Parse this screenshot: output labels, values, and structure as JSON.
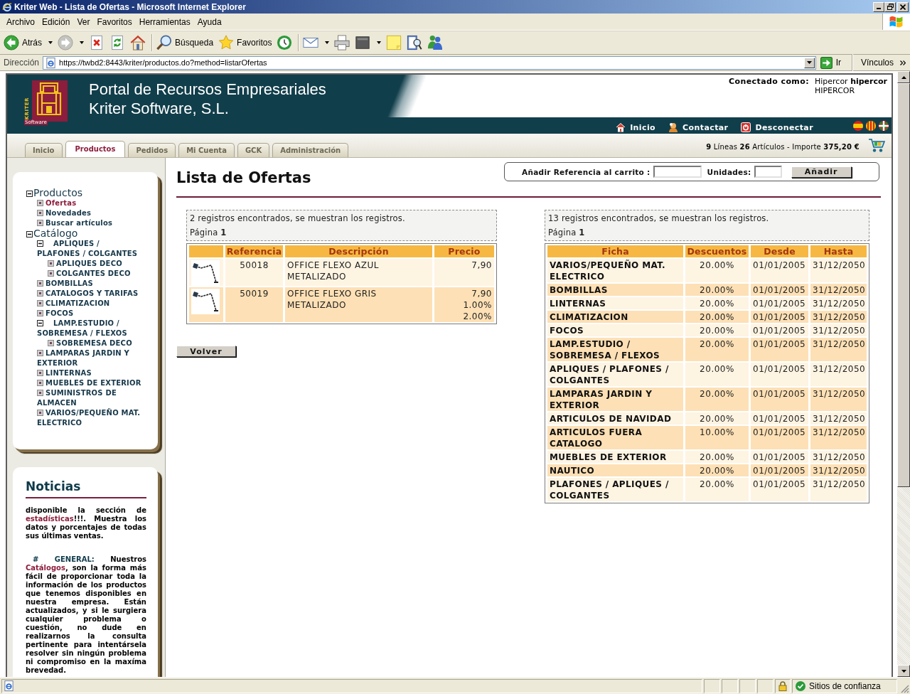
{
  "window": {
    "title": "Kriter Web - Lista de Ofertas - Microsoft Internet Explorer"
  },
  "menu_bar": [
    "Archivo",
    "Edición",
    "Ver",
    "Favoritos",
    "Herramientas",
    "Ayuda"
  ],
  "toolbar": [
    {
      "kind": "back",
      "label": "Atrás"
    },
    {
      "kind": "forward"
    },
    {
      "kind": "stop"
    },
    {
      "kind": "refresh"
    },
    {
      "kind": "home"
    },
    {
      "kind": "search",
      "label": "Búsqueda"
    },
    {
      "kind": "favorites",
      "label": "Favoritos"
    },
    {
      "kind": "history"
    },
    {
      "kind": "mail"
    },
    {
      "kind": "print"
    },
    {
      "kind": "edit"
    },
    {
      "kind": "notes"
    },
    {
      "kind": "research"
    },
    {
      "kind": "messenger"
    }
  ],
  "address_bar": {
    "label": "Dirección",
    "url": "https://twbd2:8443/kriter/productos.do?method=listarOfertas",
    "go": "Ir",
    "links": "Vínculos"
  },
  "header": {
    "logo_vertical": "KRITER",
    "logo_caption": "Software",
    "title_lines": [
      "Portal de Recursos Empresariales",
      "Kriter Software, S.L."
    ],
    "connected_label": "Conectado como:",
    "user": "Hipercor **hipercor**",
    "company": "HIPERCOR",
    "nav": [
      {
        "kind": "home",
        "label": "Inicio"
      },
      {
        "kind": "contact",
        "label": "Contactar"
      },
      {
        "kind": "logout",
        "label": "Desconectar"
      }
    ]
  },
  "tabs": [
    {
      "label": "Inicio",
      "selected": false
    },
    {
      "label": "Productos",
      "selected": true
    },
    {
      "label": "Pedidos",
      "selected": false
    },
    {
      "label": "Mi Cuenta",
      "selected": false
    },
    {
      "label": "GCK",
      "selected": false
    },
    {
      "label": "Administración",
      "selected": false
    }
  ],
  "cart_summary": "**9** Líneas **26** Artículos - Importe **375,20 €**",
  "sidebar": {
    "tree": [
      {
        "label": "Productos",
        "expanded": true,
        "selected": false,
        "children": [
          {
            "label": "Ofertas",
            "expanded": false,
            "selected": true
          },
          {
            "label": "Novedades",
            "expanded": false,
            "selected": false
          },
          {
            "label": "Buscar artículos",
            "expanded": false,
            "selected": false
          }
        ]
      },
      {
        "label": "Catálogo",
        "expanded": true,
        "selected": false,
        "children": [
          {
            "label": "APLIQUES / PLAFONES / COLGANTES",
            "expanded": true,
            "selected": false,
            "children": [
              {
                "label": "APLIQUES DECO",
                "expanded": false,
                "selected": false
              },
              {
                "label": "COLGANTES DECO",
                "expanded": false,
                "selected": false
              }
            ]
          },
          {
            "label": "BOMBILLAS",
            "expanded": false,
            "selected": false
          },
          {
            "label": "CATALOGOS Y TARIFAS",
            "expanded": false,
            "selected": false
          },
          {
            "label": "CLIMATIZACION",
            "expanded": false,
            "selected": false
          },
          {
            "label": "FOCOS",
            "expanded": false,
            "selected": false
          },
          {
            "label": "LAMP.ESTUDIO / SOBREMESA / FLEXOS",
            "expanded": true,
            "selected": false,
            "children": [
              {
                "label": "SOBREMESA DECO",
                "expanded": false,
                "selected": false
              }
            ]
          },
          {
            "label": "LAMPARAS JARDIN Y EXTERIOR",
            "expanded": false,
            "selected": false
          },
          {
            "label": "LINTERNAS",
            "expanded": false,
            "selected": false
          },
          {
            "label": "MUEBLES DE EXTERIOR",
            "expanded": false,
            "selected": false
          },
          {
            "label": "SUMINISTROS DE ALMACEN",
            "expanded": false,
            "selected": false
          },
          {
            "label": "VARIOS/PEQUEÑO MAT. ELECTRICO",
            "expanded": false,
            "selected": false
          }
        ]
      }
    ]
  },
  "news": {
    "title": "Noticias",
    "paragraphs": [
      [
        {
          "kind": "text",
          "text": "disponible la sección de "
        },
        {
          "kind": "link",
          "text": "estadísticas"
        },
        {
          "kind": "text",
          "text": "!!!. Muestra los datos y porcentajes de todas sus últimas ventas."
        }
      ],
      [
        {
          "kind": "label",
          "text": "# GENERAL:"
        },
        {
          "kind": "text",
          "text": " Nuestros "
        },
        {
          "kind": "link",
          "text": "Catálogos"
        },
        {
          "kind": "text",
          "text": ", son la forma más fácil de proporcionar toda la información de los productos que tenemos disponibles en nuestra empresa. Están actualizados, y si le surgiera cualquier problema o cuestión, no dude en realizarnos la consulta pertinente para intentársela resolver sin ningún problema ni compromiso en la maxíma brevedad."
        }
      ]
    ]
  },
  "content": {
    "title": "Lista de Ofertas",
    "add_to_cart": {
      "reference_label": "Añadir Referencia al carrito :",
      "units_label": "Unidades:",
      "button": "Añadir"
    },
    "offers": {
      "summary": "2 registros encontrados, se muestran los registros.",
      "page_label": "Página",
      "page": "1",
      "columns": [
        "Referencia",
        "Descripción",
        "Precio"
      ],
      "rows": [
        {
          "reference": "50018",
          "description": "OFFICE FLEXO AZUL METALIZADO",
          "prices": [
            "7,90"
          ]
        },
        {
          "reference": "50019",
          "description": "OFFICE FLEXO GRIS METALIZADO",
          "prices": [
            "7,90",
            "1.00%",
            "2.00%"
          ]
        }
      ]
    },
    "back_button": "Volver",
    "discounts": {
      "summary": "13 registros encontrados, se muestran los registros.",
      "page_label": "Página",
      "page": "1",
      "columns": [
        "Ficha",
        "Descuentos",
        "Desde",
        "Hasta"
      ],
      "rows": [
        [
          "VARIOS/PEQUEÑO MAT. ELECTRICO",
          "20.00%",
          "01/01/2005",
          "31/12/2050"
        ],
        [
          "BOMBILLAS",
          "20.00%",
          "01/01/2005",
          "31/12/2050"
        ],
        [
          "LINTERNAS",
          "20.00%",
          "01/01/2005",
          "31/12/2050"
        ],
        [
          "CLIMATIZACION",
          "20.00%",
          "01/01/2005",
          "31/12/2050"
        ],
        [
          "FOCOS",
          "20.00%",
          "01/01/2005",
          "31/12/2050"
        ],
        [
          "LAMP.ESTUDIO / SOBREMESA / FLEXOS",
          "20.00%",
          "01/01/2005",
          "31/12/2050"
        ],
        [
          "APLIQUES / PLAFONES / COLGANTES",
          "20.00%",
          "01/01/2005",
          "31/12/2050"
        ],
        [
          "LAMPARAS JARDIN Y EXTERIOR",
          "20.00%",
          "01/01/2005",
          "31/12/2050"
        ],
        [
          "ARTICULOS DE NAVIDAD",
          "20.00%",
          "01/01/2005",
          "31/12/2050"
        ],
        [
          "ARTICULOS FUERA CATALOGO",
          "10.00%",
          "01/01/2005",
          "31/12/2050"
        ],
        [
          "MUEBLES DE EXTERIOR",
          "20.00%",
          "01/01/2005",
          "31/12/2050"
        ],
        [
          "NAUTICO",
          "20.00%",
          "01/01/2005",
          "31/12/2050"
        ],
        [
          "PLAFONES / APLIQUES / COLGANTES",
          "20.00%",
          "01/01/2005",
          "31/12/2050"
        ]
      ]
    }
  },
  "status_bar": {
    "zone": "Sitios de confianza"
  }
}
